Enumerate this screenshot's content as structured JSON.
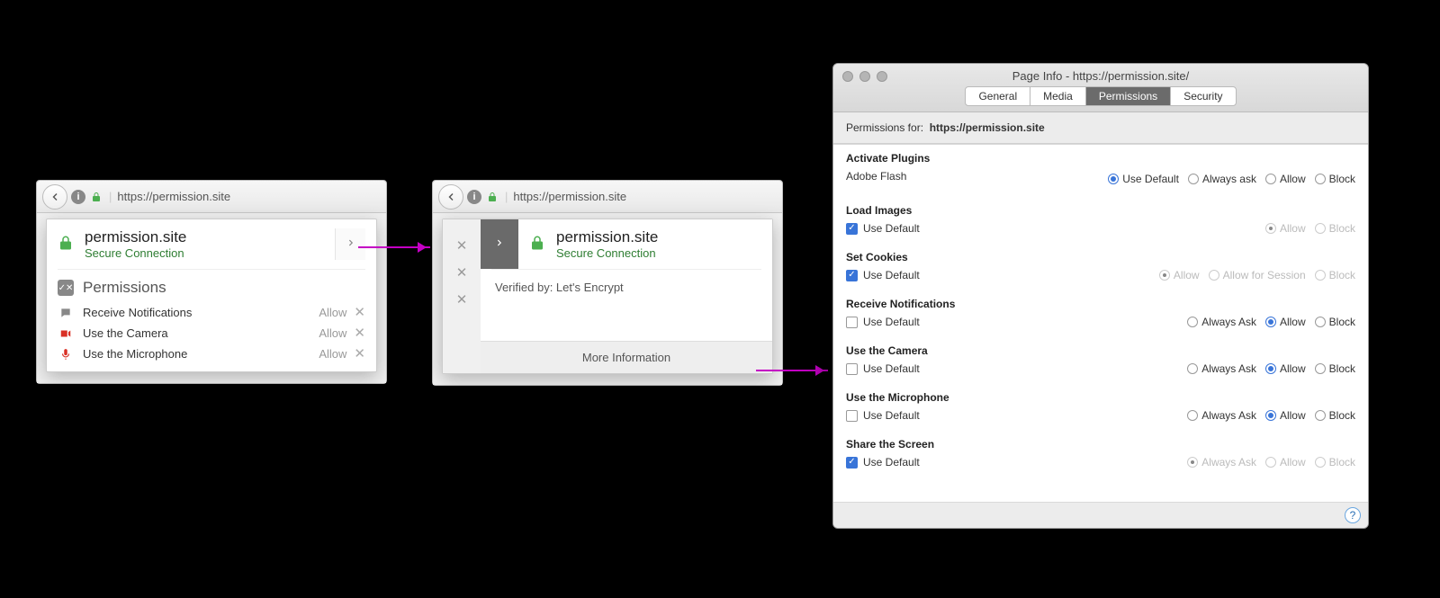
{
  "url_bar": {
    "url": "https://permission.site"
  },
  "popover1": {
    "site": "permission.site",
    "secure": "Secure Connection",
    "perm_heading": "Permissions",
    "items": [
      {
        "icon": "chat",
        "label": "Receive Notifications",
        "status": "Allow"
      },
      {
        "icon": "camera",
        "label": "Use the Camera",
        "status": "Allow"
      },
      {
        "icon": "mic",
        "label": "Use the Microphone",
        "status": "Allow"
      }
    ]
  },
  "popover2": {
    "site": "permission.site",
    "secure": "Secure Connection",
    "verified": "Verified by: Let's Encrypt",
    "more_info": "More Information"
  },
  "pageinfo": {
    "title": "Page Info - https://permission.site/",
    "tabs": [
      "General",
      "Media",
      "Permissions",
      "Security"
    ],
    "selected_tab": "Permissions",
    "for_label": "Permissions for:",
    "for_url": "https://permission.site",
    "use_default_label": "Use Default",
    "opts": {
      "allow": "Allow",
      "always_ask": "Always ask",
      "always_ask_cap": "Always Ask",
      "block": "Block",
      "allow_session": "Allow for Session"
    },
    "blocks": [
      {
        "hd": "Activate Plugins",
        "sub": "Adobe Flash",
        "use_default_cb": false,
        "default_selected": true,
        "options": [
          "use_default_radio",
          "always_ask",
          "allow",
          "block"
        ]
      },
      {
        "hd": "Load Images",
        "use_default_cb": true,
        "options_right": [
          "allow_dis_sel",
          "block_dis"
        ]
      },
      {
        "hd": "Set Cookies",
        "use_default_cb": true,
        "options_right": [
          "allow_dis_sel",
          "allow_session_dis",
          "block_dis"
        ]
      },
      {
        "hd": "Receive Notifications",
        "use_default_cb": false,
        "options_right": [
          "always_ask_cap",
          "allow_sel",
          "block"
        ]
      },
      {
        "hd": "Use the Camera",
        "use_default_cb": false,
        "options_right": [
          "always_ask_cap",
          "allow_sel",
          "block"
        ]
      },
      {
        "hd": "Use the Microphone",
        "use_default_cb": false,
        "options_right": [
          "always_ask_cap",
          "allow_sel",
          "block"
        ]
      },
      {
        "hd": "Share the Screen",
        "use_default_cb": true,
        "options_right": [
          "always_ask_cap_dis_sel",
          "allow_dis",
          "block_dis"
        ]
      }
    ]
  }
}
